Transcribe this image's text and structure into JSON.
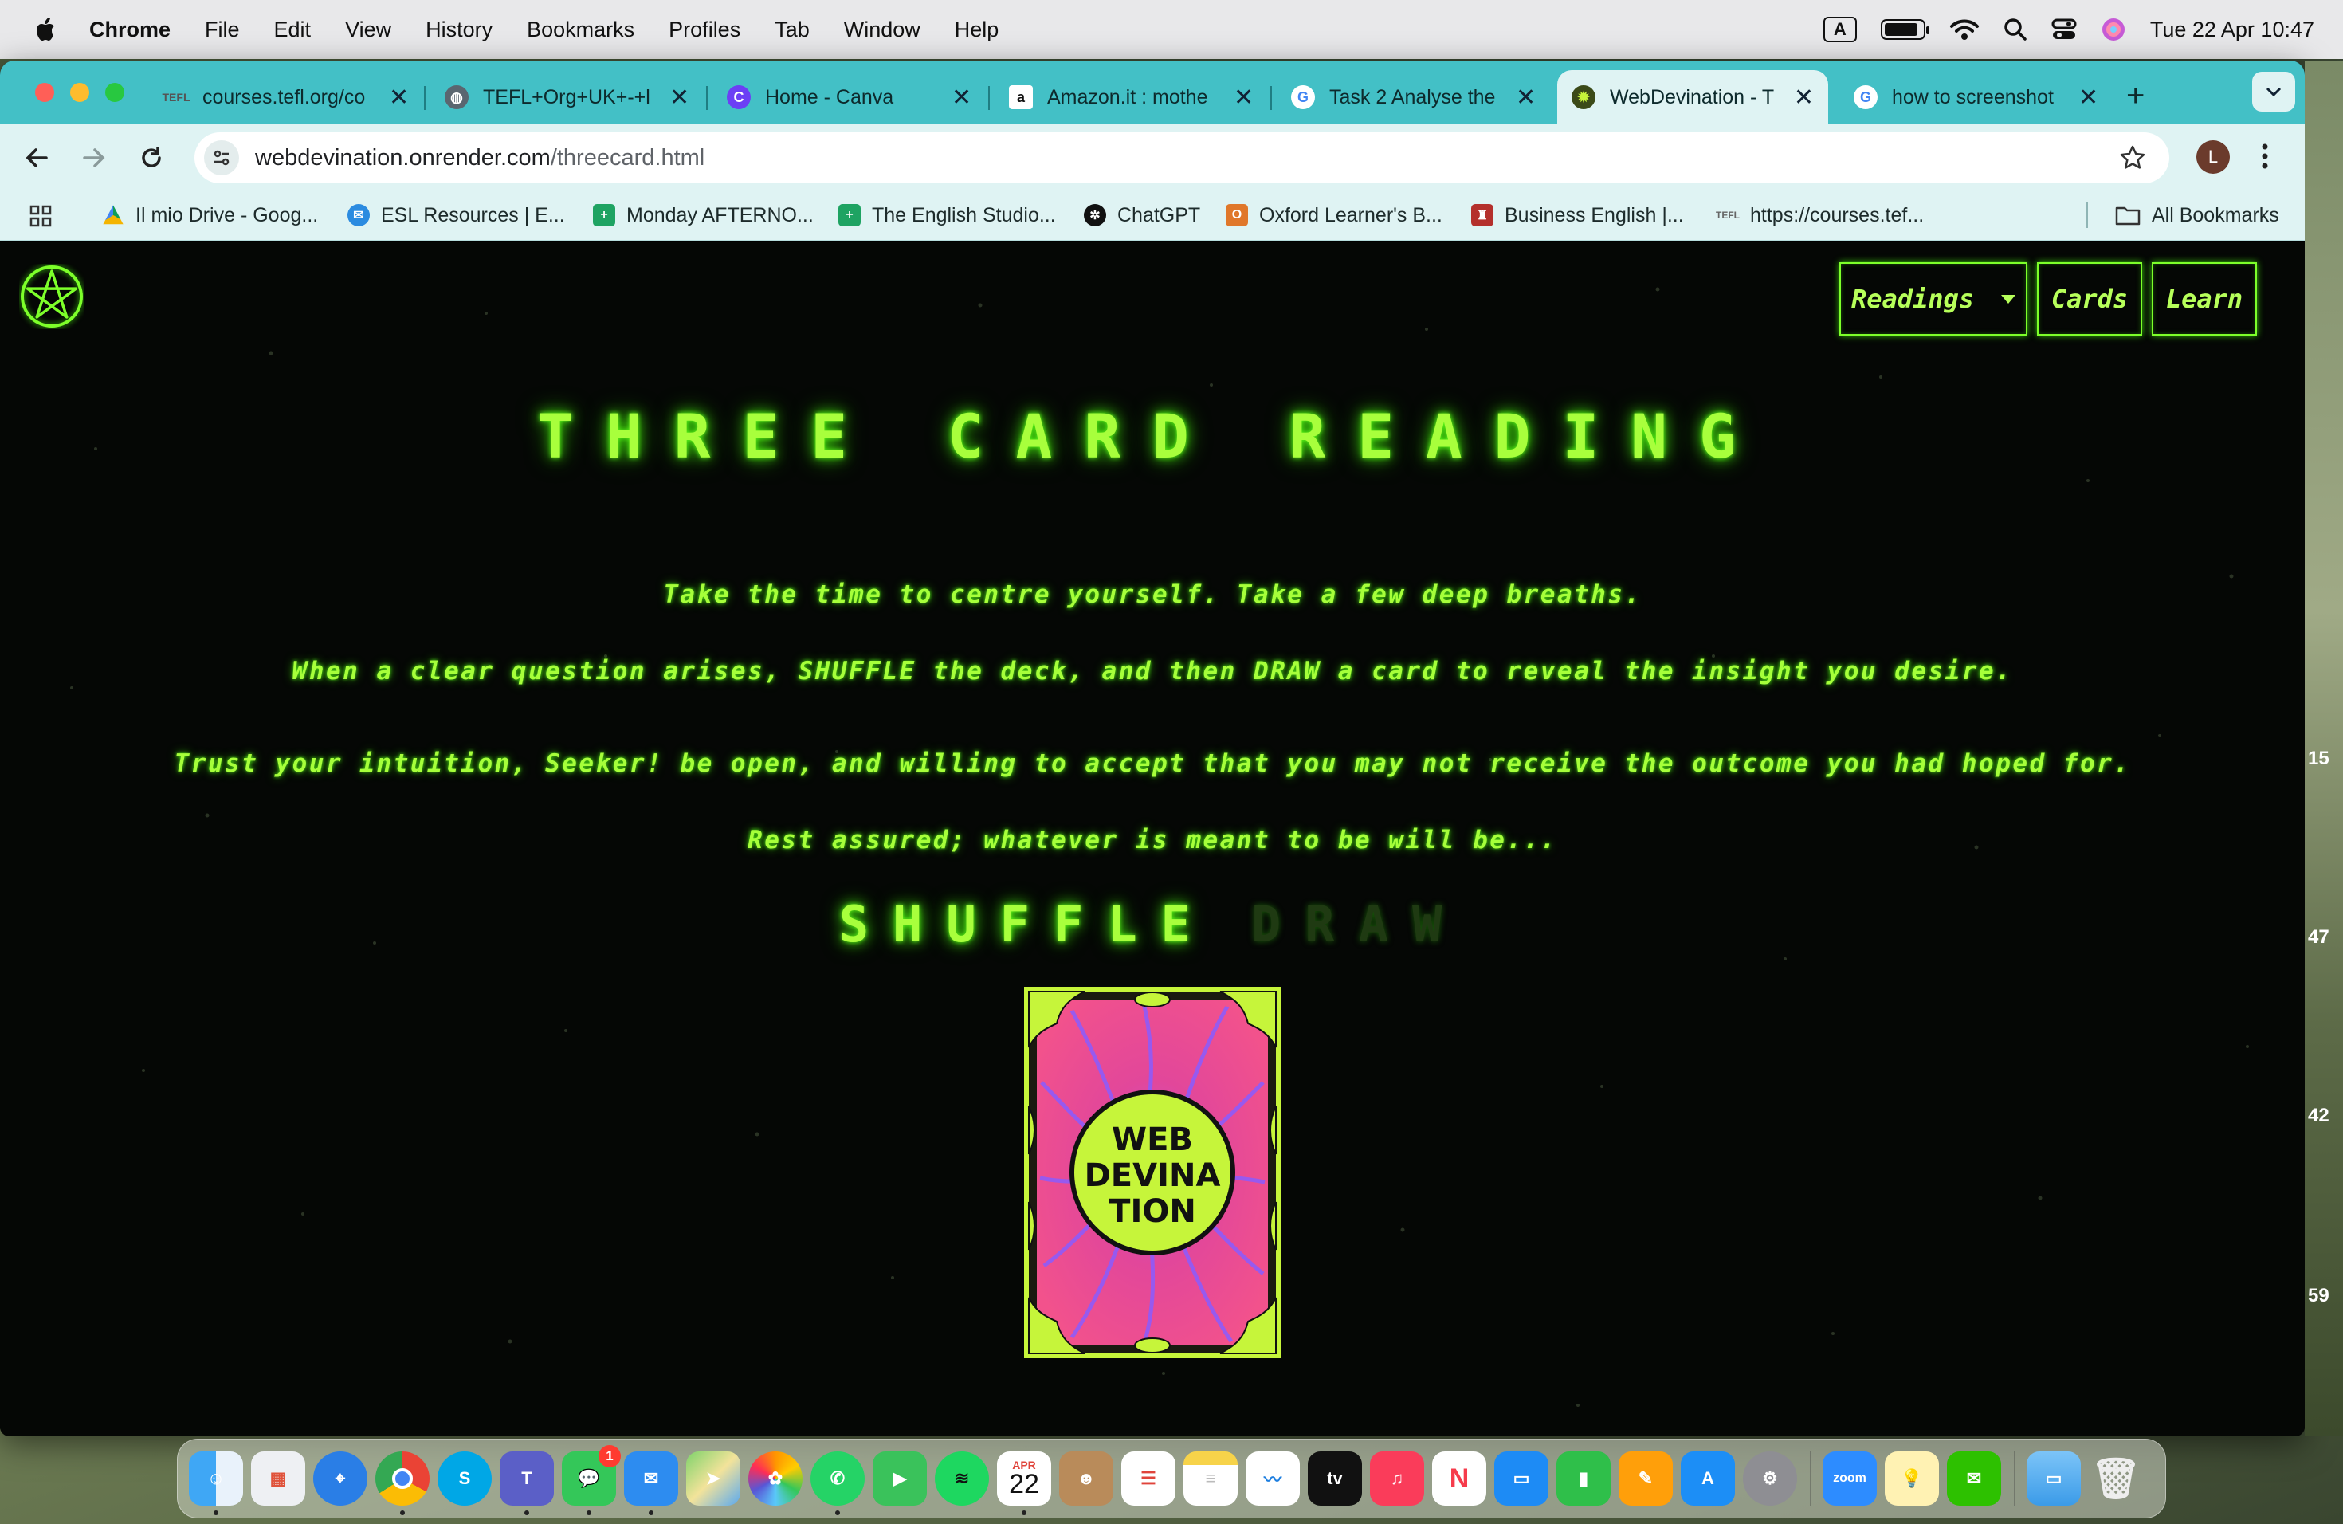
{
  "menubar": {
    "app_name": "Chrome",
    "items": [
      "File",
      "Edit",
      "View",
      "History",
      "Bookmarks",
      "Profiles",
      "Tab",
      "Window",
      "Help"
    ],
    "input_source": "A",
    "clock": "Tue 22 Apr  10:47"
  },
  "browser": {
    "tabs": [
      {
        "title": "courses.tefl.org/co",
        "favicon": "tefl-icon"
      },
      {
        "title": "TEFL+Org+UK+-+l",
        "favicon": "globe-icon"
      },
      {
        "title": "Home - Canva",
        "favicon": "canva-icon"
      },
      {
        "title": "Amazon.it : mothe",
        "favicon": "amazon-icon"
      },
      {
        "title": "Task 2 Analyse the",
        "favicon": "google-icon"
      },
      {
        "title": "WebDevination - T",
        "favicon": "webdevination-icon",
        "active": true
      },
      {
        "title": "how to screenshot",
        "favicon": "google-icon"
      }
    ],
    "url_host": "webdevination.onrender.com",
    "url_path": "/threecard.html",
    "profile_initial": "L",
    "bookmarks": [
      {
        "label": "Il mio Drive - Goog...",
        "icon": "google-drive-icon"
      },
      {
        "label": "ESL Resources | E...",
        "icon": "esl-icon"
      },
      {
        "label": "Monday AFTERNO...",
        "icon": "sheets-icon"
      },
      {
        "label": "The English Studio...",
        "icon": "sheets-icon"
      },
      {
        "label": "ChatGPT",
        "icon": "chatgpt-icon"
      },
      {
        "label": "Oxford Learner's B...",
        "icon": "oxford-icon"
      },
      {
        "label": "Business English |...",
        "icon": "cambridge-icon"
      },
      {
        "label": "https://courses.tef...",
        "icon": "tefl-icon"
      }
    ],
    "all_bookmarks": "All Bookmarks"
  },
  "site": {
    "nav": {
      "readings": "Readings",
      "cards": "Cards",
      "learn": "Learn"
    },
    "title": "THREE CARD READING",
    "paragraphs": [
      "Take the time to centre yourself. Take a few deep breaths.",
      "When a clear question arises, SHUFFLE the deck, and then DRAW a card to reveal the insight you desire.",
      "Trust your intuition, Seeker! be open, and willing to accept that you may not receive the outcome you had hoped for.",
      "Rest assured; whatever is meant to be will be..."
    ],
    "shuffle_label": "SHUFFLE",
    "draw_label": "DRAW",
    "card_back_text": [
      "WEB",
      "DEVINA",
      "TION"
    ],
    "colors": {
      "neon": "#9cff3a",
      "card_pink": "#f0458f",
      "card_lime": "#c6f53a"
    }
  },
  "desktop": {
    "strip_numbers": [
      "15",
      "47",
      "42",
      "59"
    ]
  },
  "dock": {
    "calendar_month": "APR",
    "calendar_day": "22",
    "messages_badge": "1",
    "zoom_label": "zoom",
    "tv_label": "tv"
  }
}
